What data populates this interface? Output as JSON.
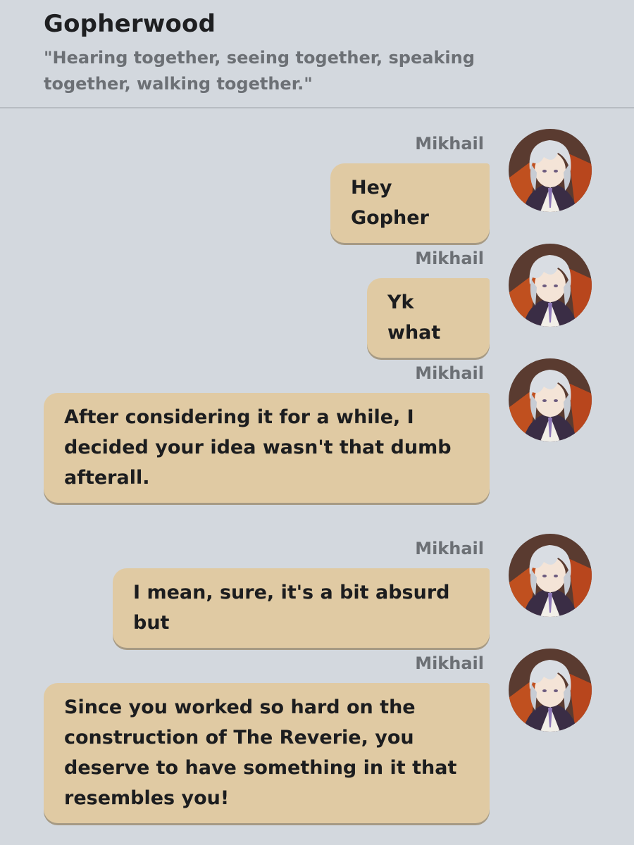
{
  "header": {
    "title": "Gopherwood",
    "subtitle": "\"Hearing together, seeing together, speaking together, walking together.\""
  },
  "messages": [
    {
      "sender": "Mikhail",
      "text": "Hey Gopher",
      "avatar": "mikhail-avatar"
    },
    {
      "sender": "Mikhail",
      "text": "Yk what",
      "avatar": "mikhail-avatar"
    },
    {
      "sender": "Mikhail",
      "text": "After considering it for a while, I decided your idea wasn't that dumb afterall.",
      "avatar": "mikhail-avatar"
    },
    {
      "sender": "Mikhail",
      "text": "I mean, sure, it's a bit absurd but",
      "avatar": "mikhail-avatar"
    },
    {
      "sender": "Mikhail",
      "text": "Since you worked so hard on the construction of The Reverie, you deserve to have something in it that resembles you!",
      "avatar": "mikhail-avatar"
    }
  ],
  "colors": {
    "background": "#d3d8de",
    "bubble": "#e0caa3",
    "bubble_shadow": "#a69a84",
    "muted_text": "#6c7075"
  }
}
